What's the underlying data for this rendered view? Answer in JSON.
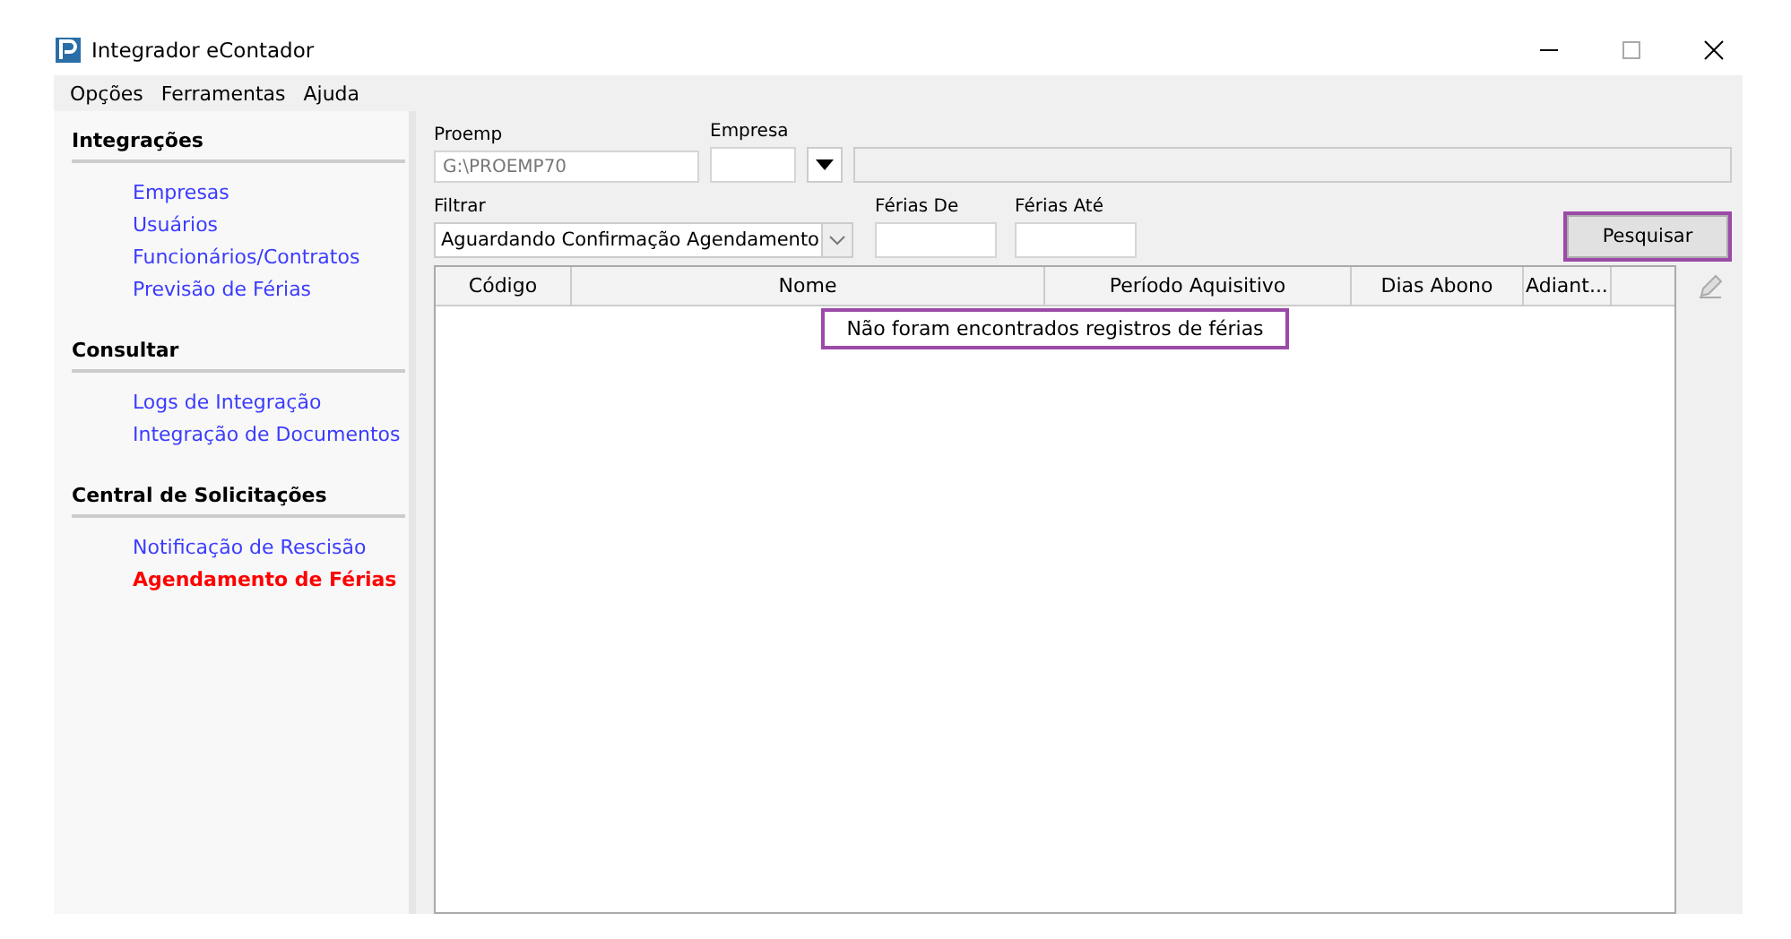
{
  "window": {
    "title": "Integrador eContador"
  },
  "menu": [
    "Opções",
    "Ferramentas",
    "Ajuda"
  ],
  "sidebar": {
    "sections": [
      {
        "title": "Integrações",
        "items": [
          {
            "label": "Empresas",
            "selected": false
          },
          {
            "label": "Usuários",
            "selected": false
          },
          {
            "label": "Funcionários/Contratos",
            "selected": false
          },
          {
            "label": "Previsão de Férias",
            "selected": false
          }
        ]
      },
      {
        "title": "Consultar",
        "items": [
          {
            "label": "Logs de Integração",
            "selected": false
          },
          {
            "label": "Integração de Documentos",
            "selected": false
          }
        ]
      },
      {
        "title": "Central de Solicitações",
        "items": [
          {
            "label": "Notificação de Rescisão",
            "selected": false
          },
          {
            "label": "Agendamento de Férias",
            "selected": true
          }
        ]
      }
    ]
  },
  "form": {
    "proemp": {
      "label": "Proemp",
      "value": "G:\\PROEMP70"
    },
    "empresa": {
      "label": "Empresa"
    },
    "filtrar": {
      "label": "Filtrar",
      "value": "Aguardando Confirmação Agendamento"
    },
    "ferias_de": {
      "label": "Férias De"
    },
    "ferias_ate": {
      "label": "Férias Até"
    },
    "search_button": {
      "label": "Pesquisar",
      "highlighted": true
    }
  },
  "table": {
    "columns": [
      "Código",
      "Nome",
      "Período Aquisitivo",
      "Dias Abono",
      "Adiant..."
    ],
    "empty_message": {
      "text": "Não foram encontrados registros de férias",
      "highlighted": true
    }
  }
}
